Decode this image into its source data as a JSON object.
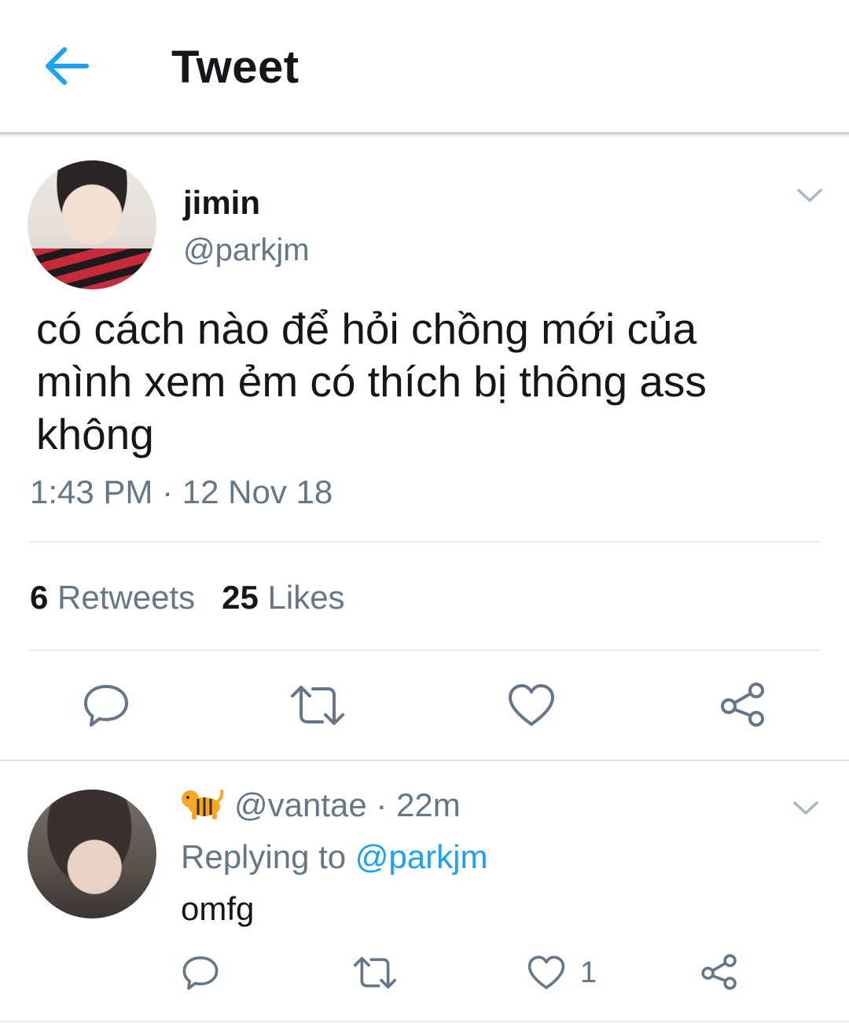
{
  "header": {
    "title": "Tweet",
    "back_icon": "arrow-left-icon",
    "accent_color": "#1da1f2"
  },
  "tweet": {
    "display_name": "jimin",
    "handle": "@parkjm",
    "text": "có cách nào để hỏi chồng mới của\nmình xem ẻm có thích bị thông ass\nkhông",
    "timestamp": "1:43 PM · 12 Nov 18",
    "retweets_count": "6",
    "retweets_label": "Retweets",
    "likes_count": "25",
    "likes_label": "Likes",
    "actions": [
      "reply-icon",
      "retweet-icon",
      "like-icon",
      "share-icon"
    ]
  },
  "reply": {
    "emoji_icon": "tiger-icon",
    "handle": "@vantae",
    "separator": " · ",
    "time_ago": "22m",
    "replying_prefix": "Replying to ",
    "replying_handle": "@parkjm",
    "text": "omfg",
    "like_count": "1",
    "actions": [
      "reply-icon",
      "retweet-icon",
      "like-icon",
      "share-icon"
    ]
  },
  "colors": {
    "text_primary": "#14171a",
    "text_secondary": "#657786",
    "divider": "#e6ecf0"
  }
}
